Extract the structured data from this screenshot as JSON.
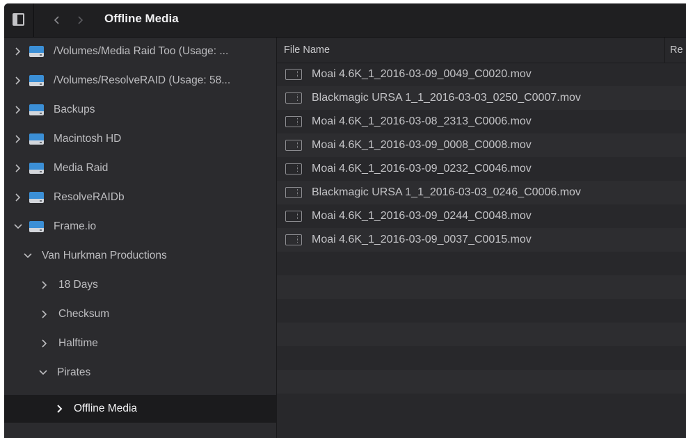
{
  "toolbar": {
    "title": "Offline Media",
    "sidebar_toggle_icon": "sidebar-toggle-icon",
    "back_icon": "chevron-left-icon",
    "forward_icon": "chevron-right-icon"
  },
  "sidebar": {
    "items": [
      {
        "label": "/Volumes/Media Raid Too (Usage: ...",
        "expanded": false,
        "icon": "drive-icon"
      },
      {
        "label": "/Volumes/ResolveRAID (Usage: 58...",
        "expanded": false,
        "icon": "drive-icon"
      },
      {
        "label": "Backups",
        "expanded": false,
        "icon": "drive-icon"
      },
      {
        "label": "Macintosh HD",
        "expanded": false,
        "icon": "drive-icon"
      },
      {
        "label": "Media Raid",
        "expanded": false,
        "icon": "drive-icon"
      },
      {
        "label": "ResolveRAIDb",
        "expanded": false,
        "icon": "drive-icon"
      },
      {
        "label": "Frame.io",
        "expanded": true,
        "icon": "drive-icon"
      },
      {
        "label": "Van Hurkman Productions",
        "expanded": true
      },
      {
        "label": "18 Days",
        "expanded": false
      },
      {
        "label": "Checksum",
        "expanded": false
      },
      {
        "label": "Halftime",
        "expanded": false
      },
      {
        "label": "Pirates",
        "expanded": true
      },
      {
        "label": "Offline Media",
        "expanded": false,
        "selected": true
      }
    ]
  },
  "table": {
    "columns": [
      "File Name",
      "Re"
    ],
    "files": [
      "Moai 4.6K_1_2016-03-09_0049_C0020.mov",
      "Blackmagic URSA 1_1_2016-03-03_0250_C0007.mov",
      "Moai 4.6K_1_2016-03-08_2313_C0006.mov",
      "Moai 4.6K_1_2016-03-09_0008_C0008.mov",
      "Moai 4.6K_1_2016-03-09_0232_C0046.mov",
      "Blackmagic URSA 1_1_2016-03-03_0246_C0006.mov",
      "Moai 4.6K_1_2016-03-09_0244_C0048.mov",
      "Moai 4.6K_1_2016-03-09_0037_C0015.mov"
    ],
    "file_icon": "film-clip-icon"
  },
  "colors": {
    "drive_accent": "#3b8fd6",
    "selected_row": "#1b1b1d"
  }
}
